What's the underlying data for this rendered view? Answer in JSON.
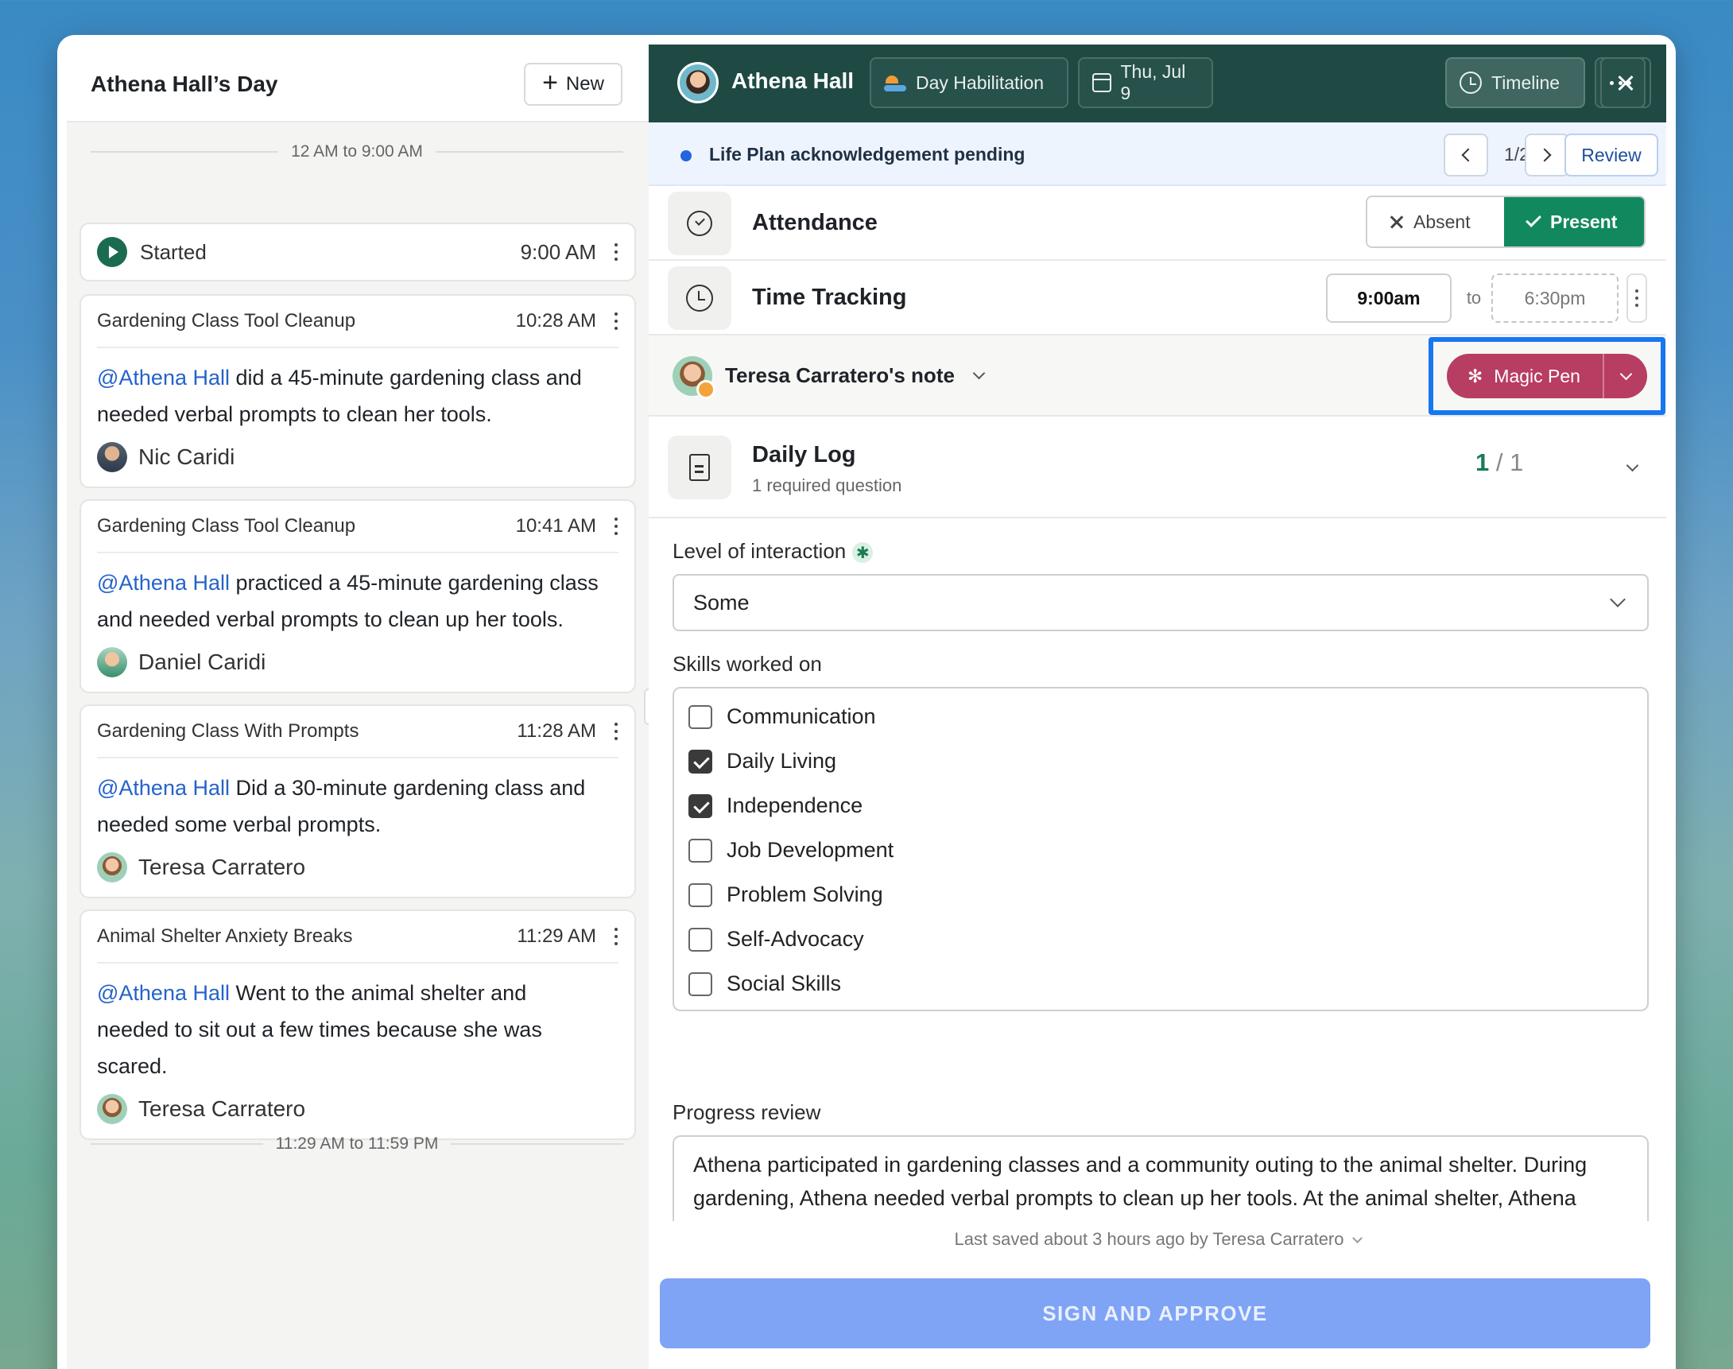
{
  "left": {
    "title": "Athena Hall’s Day",
    "new_label": "New",
    "divider_top": "12 AM to 9:00 AM",
    "divider_bottom": "11:29 AM to 11:59 PM",
    "started": {
      "label": "Started",
      "time": "9:00 AM"
    },
    "entries": [
      {
        "title": "Gardening Class Tool Cleanup",
        "time": "10:28 AM",
        "mention": "@Athena Hall",
        "line1": " did a 45-minute gardening class and",
        "line2": "needed verbal prompts to clean her tools.",
        "author": "Nic Caridi"
      },
      {
        "title": "Gardening Class Tool Cleanup",
        "time": "10:41 AM",
        "mention": "@Athena Hall",
        "line1": " practiced a 45-minute gardening class",
        "line2": "and needed verbal prompts to clean up her tools.",
        "author": "Daniel Caridi"
      },
      {
        "title": "Gardening Class With Prompts",
        "time": "11:28 AM",
        "mention": "@Athena Hall",
        "line1": " Did a 30-minute gardening class and",
        "line2": "needed some verbal prompts.",
        "author": "Teresa Carratero"
      },
      {
        "title": "Animal Shelter Anxiety Breaks",
        "time": "11:29 AM",
        "mention": "@Athena Hall",
        "line1": " Went to the animal shelter and",
        "line2": "needed to sit out a few times because she was",
        "line3": "scared.",
        "author": "Teresa Carratero"
      }
    ]
  },
  "header": {
    "name": "Athena Hall",
    "service": "Day Habilitation",
    "date": "Thu, Jul 9",
    "timeline": "Timeline"
  },
  "banner": {
    "text": "Life Plan acknowledgement pending",
    "page": "1/2",
    "review": "Review"
  },
  "attendance": {
    "title": "Attendance",
    "absent": "Absent",
    "present": "Present"
  },
  "time_tracking": {
    "title": "Time Tracking",
    "start": "9:00am",
    "to": "to",
    "end": "6:30pm"
  },
  "note": {
    "title": "Teresa Carratero's note",
    "magic_pen": "Magic Pen"
  },
  "daily_log": {
    "title": "Daily Log",
    "subtitle": "1 required question",
    "count_done": "1",
    "count_sep": " / ",
    "count_total": "1"
  },
  "form": {
    "interaction_label": "Level of interaction",
    "interaction_value": "Some",
    "skills_label": "Skills worked on",
    "skills": [
      {
        "label": "Communication",
        "checked": false
      },
      {
        "label": "Daily Living",
        "checked": true
      },
      {
        "label": "Independence",
        "checked": true
      },
      {
        "label": "Job Development",
        "checked": false
      },
      {
        "label": "Problem Solving",
        "checked": false
      },
      {
        "label": "Self-Advocacy",
        "checked": false
      },
      {
        "label": "Social Skills",
        "checked": false
      }
    ],
    "progress_label": "Progress review",
    "progress_text": "Athena participated in gardening classes and a community outing to the animal shelter. During gardening, Athena needed verbal prompts to clean up her tools. At the animal shelter, Athena needed to sit out a few times because she was scared."
  },
  "footer": {
    "saved": "Last saved about 3 hours ago by Teresa Carratero",
    "sign": "SIGN AND APPROVE"
  },
  "colors": {
    "header_bg": "#1f4a44",
    "present_green": "#12885f",
    "magic_pen": "#b83d62",
    "highlight_frame": "#1676f3",
    "sign_button": "#7fa3f5",
    "mention": "#2563c9"
  }
}
